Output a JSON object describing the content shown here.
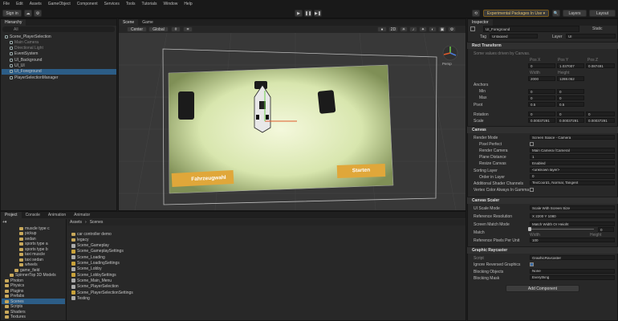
{
  "menu": [
    "File",
    "Edit",
    "Assets",
    "GameObject",
    "Component",
    "Services",
    "Tools",
    "Tutorials",
    "Window",
    "Help"
  ],
  "toolbar": {
    "signin": "Sign in",
    "experimental": "Experimental Packages In Use ▾",
    "layers": "Layers",
    "layout": "Layout"
  },
  "hierarchy": {
    "tab": "Hierarchy",
    "search_placeholder": "All",
    "items": [
      {
        "label": "Scene_PlayerSelection",
        "dim": false,
        "indent": 0
      },
      {
        "label": "Main Camera",
        "dim": true,
        "indent": 1
      },
      {
        "label": "Directional Light",
        "dim": true,
        "indent": 1
      },
      {
        "label": "EventSystem",
        "dim": false,
        "indent": 1
      },
      {
        "label": "UI_Background",
        "dim": false,
        "indent": 1
      },
      {
        "label": "UI_UI",
        "dim": false,
        "indent": 1
      },
      {
        "label": "UI_Foreground",
        "dim": false,
        "indent": 1
      },
      {
        "label": "PlayerSelectionManager",
        "dim": false,
        "indent": 1
      }
    ]
  },
  "scene": {
    "tabs": [
      "Scene",
      "Game"
    ],
    "pivot": "Center",
    "space": "Global",
    "mode": "2D",
    "persp": "Persp",
    "btn_left": "Fahrzeugwahl",
    "btn_right": "Starten"
  },
  "inspector": {
    "tab": "Inspector",
    "object_name": "UI_Foreground",
    "static": "Static",
    "tag_label": "Tag",
    "tag": "Untagged",
    "layer_label": "Layer",
    "layer": "UI",
    "rect": {
      "title": "Rect Transform",
      "note": "Some values driven by Canvas.",
      "pos_labels": [
        "Pos X",
        "Pos Y",
        "Pos Z"
      ],
      "pos": [
        "0",
        "1.037007",
        "0.087491"
      ],
      "wh_labels": [
        "Width",
        "Height"
      ],
      "wh": [
        "2000",
        "1288.052"
      ],
      "anchors": "Anchors",
      "min": "Min",
      "max": "Max",
      "min_vals": [
        "0",
        "0"
      ],
      "max_vals": [
        "0",
        "0"
      ],
      "pivot": "Pivot",
      "pivot_vals": [
        "0.5",
        "0.5"
      ],
      "rotation": "Rotation",
      "rot_vals": [
        "0",
        "0",
        "0"
      ],
      "scale": "Scale",
      "scale_vals": [
        "0.00037291",
        "0.00037291",
        "0.00037291"
      ]
    },
    "canvas": {
      "title": "Canvas",
      "fields": [
        [
          "Render Mode",
          "Screen Space - Camera"
        ],
        [
          "Pixel Perfect",
          ""
        ],
        [
          "Render Camera",
          "Main Camera (Camera)"
        ],
        [
          "Plane Distance",
          "1"
        ],
        [
          "Resize Canvas",
          "Enabled"
        ],
        [
          "Sorting Layer",
          "<unknown layer>"
        ],
        [
          "Order in Layer",
          "0"
        ],
        [
          "Additional Shader Channels",
          "TexCoord1, Normal, Tangent"
        ],
        [
          "Vertex Color Always In Gamma",
          ""
        ]
      ]
    },
    "scaler": {
      "title": "Canvas Scaler",
      "fields": [
        [
          "UI Scale Mode",
          "Scale With Screen Size"
        ],
        [
          "Reference Resolution",
          "X 2200   Y 1080"
        ],
        [
          "Screen Match Mode",
          "Match Width Or Height"
        ],
        [
          "Match",
          ""
        ],
        [
          "Reference Pixels Per Unit",
          "100"
        ]
      ],
      "width": "Width",
      "height": "Height",
      "match_val": "0"
    },
    "raycaster": {
      "title": "Graphic Raycaster",
      "fields": [
        [
          "Script",
          "GraphicRaycaster"
        ],
        [
          "Ignore Reversed Graphics",
          ""
        ],
        [
          "Blocking Objects",
          "None"
        ],
        [
          "Blocking Mask",
          "Everything"
        ]
      ]
    },
    "add_component": "Add Component"
  },
  "bottom": {
    "tabs": [
      "Project",
      "Console",
      "Animation",
      "Animator"
    ],
    "breadcrumb": [
      "Assets",
      "Scenes"
    ],
    "tree": [
      {
        "label": "muscle type c",
        "indent": 3
      },
      {
        "label": "pickup",
        "indent": 3
      },
      {
        "label": "sedan",
        "indent": 3
      },
      {
        "label": "sports type a",
        "indent": 3
      },
      {
        "label": "sports type b",
        "indent": 3
      },
      {
        "label": "taxi muscle",
        "indent": 3
      },
      {
        "label": "taxi sedan",
        "indent": 3
      },
      {
        "label": "wheels",
        "indent": 3
      },
      {
        "label": "game_field",
        "indent": 2
      },
      {
        "label": "SpinnerTop 3D Models",
        "indent": 1
      },
      {
        "label": "Photon",
        "indent": 0
      },
      {
        "label": "Physics",
        "indent": 0
      },
      {
        "label": "Plugins",
        "indent": 0
      },
      {
        "label": "Prefabs",
        "indent": 0
      },
      {
        "label": "Scenes",
        "indent": 0
      },
      {
        "label": "Scripts",
        "indent": 0
      },
      {
        "label": "Shaders",
        "indent": 0
      },
      {
        "label": "Textures",
        "indent": 0
      }
    ],
    "files": [
      {
        "label": "car controller demo",
        "type": "folder"
      },
      {
        "label": "legacy",
        "type": "folder"
      },
      {
        "label": "Scene_Gameplay",
        "type": "scene"
      },
      {
        "label": "Scene_GameplaySettings",
        "type": "asset"
      },
      {
        "label": "Scene_Loading",
        "type": "scene"
      },
      {
        "label": "Scene_LoadingSettings",
        "type": "asset"
      },
      {
        "label": "Scene_Lobby",
        "type": "scene"
      },
      {
        "label": "Scene_LobbySettings",
        "type": "asset"
      },
      {
        "label": "Scene_Main_Menu",
        "type": "scene"
      },
      {
        "label": "Scene_PlayerSelection",
        "type": "scene"
      },
      {
        "label": "Scene_PlayerSelectionSettings",
        "type": "asset"
      },
      {
        "label": "Testing",
        "type": "scene"
      }
    ]
  }
}
